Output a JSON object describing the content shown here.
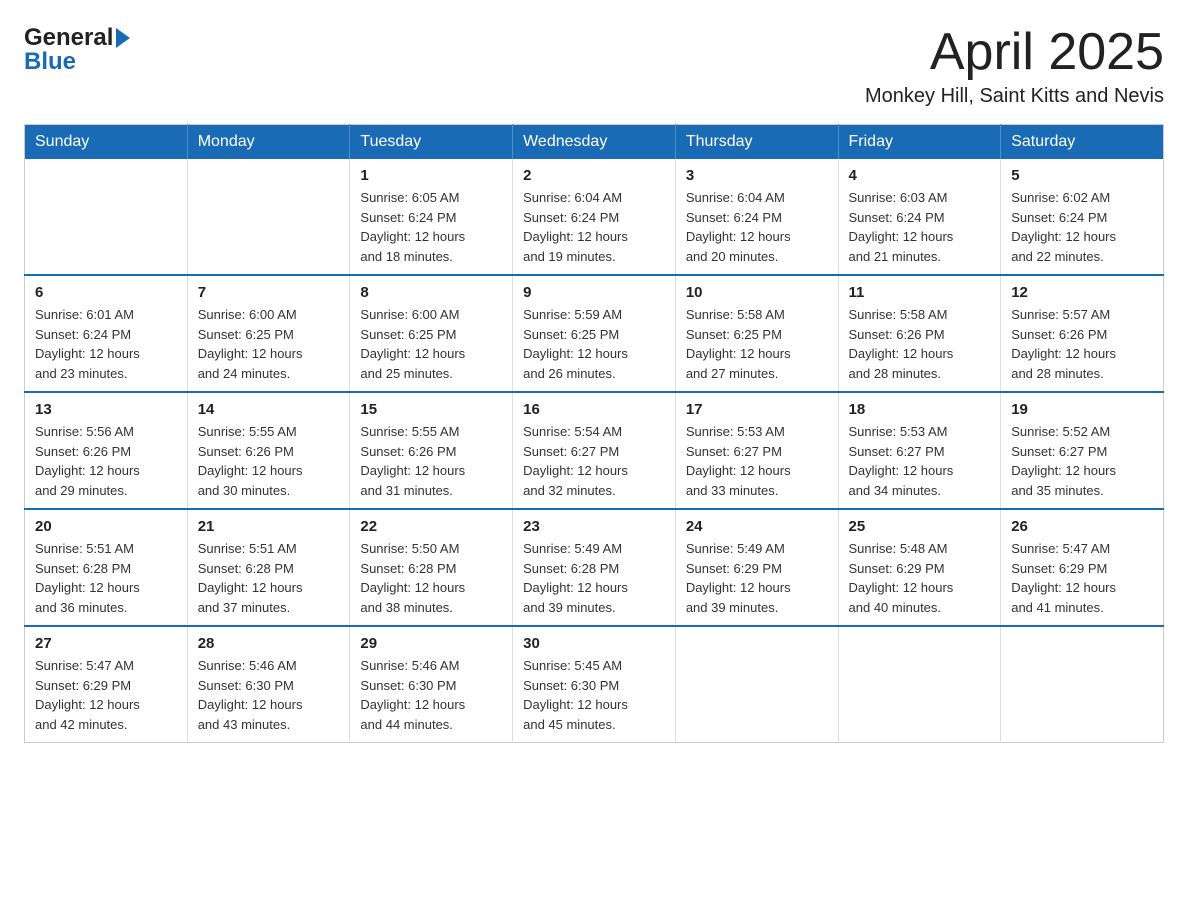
{
  "header": {
    "logo": {
      "general": "General",
      "blue": "Blue"
    },
    "title": "April 2025",
    "location": "Monkey Hill, Saint Kitts and Nevis"
  },
  "calendar": {
    "days_of_week": [
      "Sunday",
      "Monday",
      "Tuesday",
      "Wednesday",
      "Thursday",
      "Friday",
      "Saturday"
    ],
    "weeks": [
      [
        {
          "day": "",
          "info": ""
        },
        {
          "day": "",
          "info": ""
        },
        {
          "day": "1",
          "info": "Sunrise: 6:05 AM\nSunset: 6:24 PM\nDaylight: 12 hours\nand 18 minutes."
        },
        {
          "day": "2",
          "info": "Sunrise: 6:04 AM\nSunset: 6:24 PM\nDaylight: 12 hours\nand 19 minutes."
        },
        {
          "day": "3",
          "info": "Sunrise: 6:04 AM\nSunset: 6:24 PM\nDaylight: 12 hours\nand 20 minutes."
        },
        {
          "day": "4",
          "info": "Sunrise: 6:03 AM\nSunset: 6:24 PM\nDaylight: 12 hours\nand 21 minutes."
        },
        {
          "day": "5",
          "info": "Sunrise: 6:02 AM\nSunset: 6:24 PM\nDaylight: 12 hours\nand 22 minutes."
        }
      ],
      [
        {
          "day": "6",
          "info": "Sunrise: 6:01 AM\nSunset: 6:24 PM\nDaylight: 12 hours\nand 23 minutes."
        },
        {
          "day": "7",
          "info": "Sunrise: 6:00 AM\nSunset: 6:25 PM\nDaylight: 12 hours\nand 24 minutes."
        },
        {
          "day": "8",
          "info": "Sunrise: 6:00 AM\nSunset: 6:25 PM\nDaylight: 12 hours\nand 25 minutes."
        },
        {
          "day": "9",
          "info": "Sunrise: 5:59 AM\nSunset: 6:25 PM\nDaylight: 12 hours\nand 26 minutes."
        },
        {
          "day": "10",
          "info": "Sunrise: 5:58 AM\nSunset: 6:25 PM\nDaylight: 12 hours\nand 27 minutes."
        },
        {
          "day": "11",
          "info": "Sunrise: 5:58 AM\nSunset: 6:26 PM\nDaylight: 12 hours\nand 28 minutes."
        },
        {
          "day": "12",
          "info": "Sunrise: 5:57 AM\nSunset: 6:26 PM\nDaylight: 12 hours\nand 28 minutes."
        }
      ],
      [
        {
          "day": "13",
          "info": "Sunrise: 5:56 AM\nSunset: 6:26 PM\nDaylight: 12 hours\nand 29 minutes."
        },
        {
          "day": "14",
          "info": "Sunrise: 5:55 AM\nSunset: 6:26 PM\nDaylight: 12 hours\nand 30 minutes."
        },
        {
          "day": "15",
          "info": "Sunrise: 5:55 AM\nSunset: 6:26 PM\nDaylight: 12 hours\nand 31 minutes."
        },
        {
          "day": "16",
          "info": "Sunrise: 5:54 AM\nSunset: 6:27 PM\nDaylight: 12 hours\nand 32 minutes."
        },
        {
          "day": "17",
          "info": "Sunrise: 5:53 AM\nSunset: 6:27 PM\nDaylight: 12 hours\nand 33 minutes."
        },
        {
          "day": "18",
          "info": "Sunrise: 5:53 AM\nSunset: 6:27 PM\nDaylight: 12 hours\nand 34 minutes."
        },
        {
          "day": "19",
          "info": "Sunrise: 5:52 AM\nSunset: 6:27 PM\nDaylight: 12 hours\nand 35 minutes."
        }
      ],
      [
        {
          "day": "20",
          "info": "Sunrise: 5:51 AM\nSunset: 6:28 PM\nDaylight: 12 hours\nand 36 minutes."
        },
        {
          "day": "21",
          "info": "Sunrise: 5:51 AM\nSunset: 6:28 PM\nDaylight: 12 hours\nand 37 minutes."
        },
        {
          "day": "22",
          "info": "Sunrise: 5:50 AM\nSunset: 6:28 PM\nDaylight: 12 hours\nand 38 minutes."
        },
        {
          "day": "23",
          "info": "Sunrise: 5:49 AM\nSunset: 6:28 PM\nDaylight: 12 hours\nand 39 minutes."
        },
        {
          "day": "24",
          "info": "Sunrise: 5:49 AM\nSunset: 6:29 PM\nDaylight: 12 hours\nand 39 minutes."
        },
        {
          "day": "25",
          "info": "Sunrise: 5:48 AM\nSunset: 6:29 PM\nDaylight: 12 hours\nand 40 minutes."
        },
        {
          "day": "26",
          "info": "Sunrise: 5:47 AM\nSunset: 6:29 PM\nDaylight: 12 hours\nand 41 minutes."
        }
      ],
      [
        {
          "day": "27",
          "info": "Sunrise: 5:47 AM\nSunset: 6:29 PM\nDaylight: 12 hours\nand 42 minutes."
        },
        {
          "day": "28",
          "info": "Sunrise: 5:46 AM\nSunset: 6:30 PM\nDaylight: 12 hours\nand 43 minutes."
        },
        {
          "day": "29",
          "info": "Sunrise: 5:46 AM\nSunset: 6:30 PM\nDaylight: 12 hours\nand 44 minutes."
        },
        {
          "day": "30",
          "info": "Sunrise: 5:45 AM\nSunset: 6:30 PM\nDaylight: 12 hours\nand 45 minutes."
        },
        {
          "day": "",
          "info": ""
        },
        {
          "day": "",
          "info": ""
        },
        {
          "day": "",
          "info": ""
        }
      ]
    ]
  }
}
